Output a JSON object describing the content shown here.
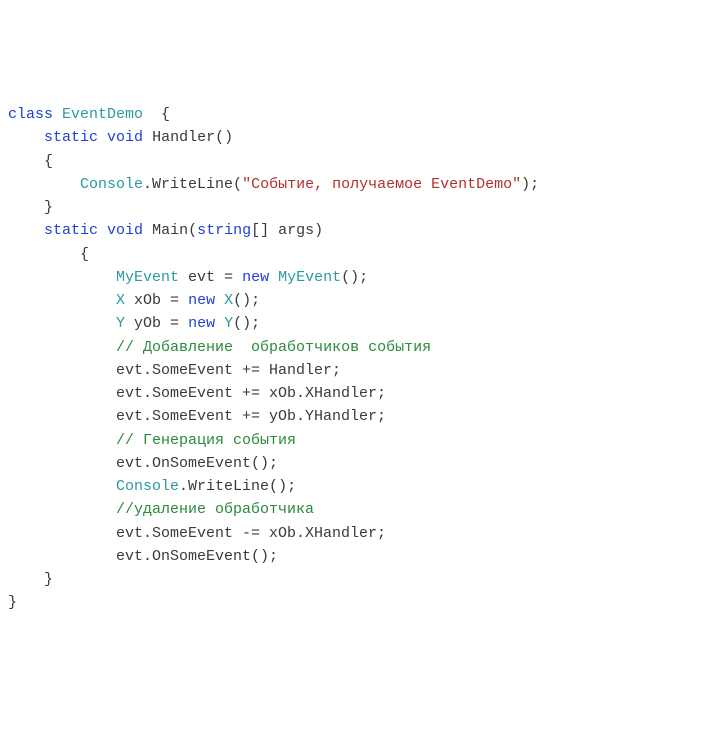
{
  "tokens": [
    [
      [
        "kw",
        "class"
      ],
      [
        "txt",
        " "
      ],
      [
        "type",
        "EventDemo"
      ],
      [
        "txt",
        "  {"
      ]
    ],
    [
      [
        "txt",
        "    "
      ],
      [
        "kw",
        "static"
      ],
      [
        "txt",
        " "
      ],
      [
        "kw",
        "void"
      ],
      [
        "txt",
        " Handler()"
      ]
    ],
    [
      [
        "txt",
        "    {"
      ]
    ],
    [
      [
        "txt",
        "        "
      ],
      [
        "type",
        "Console"
      ],
      [
        "txt",
        ".WriteLine("
      ],
      [
        "str",
        "\"Событие, получаемое EventDemo\""
      ],
      [
        "txt",
        ");"
      ]
    ],
    [
      [
        "txt",
        "    }"
      ]
    ],
    [
      [
        "txt",
        "    "
      ],
      [
        "kw",
        "static"
      ],
      [
        "txt",
        " "
      ],
      [
        "kw",
        "void"
      ],
      [
        "txt",
        " Main("
      ],
      [
        "kw",
        "string"
      ],
      [
        "txt",
        "[] args)"
      ]
    ],
    [
      [
        "txt",
        "        {"
      ]
    ],
    [
      [
        "txt",
        "            "
      ],
      [
        "type",
        "MyEvent"
      ],
      [
        "txt",
        " evt = "
      ],
      [
        "kw",
        "new"
      ],
      [
        "txt",
        " "
      ],
      [
        "type",
        "MyEvent"
      ],
      [
        "txt",
        "();"
      ]
    ],
    [
      [
        "txt",
        "            "
      ],
      [
        "type",
        "X"
      ],
      [
        "txt",
        " xOb = "
      ],
      [
        "kw",
        "new"
      ],
      [
        "txt",
        " "
      ],
      [
        "type",
        "X"
      ],
      [
        "txt",
        "();"
      ]
    ],
    [
      [
        "txt",
        "            "
      ],
      [
        "type",
        "Y"
      ],
      [
        "txt",
        " yOb = "
      ],
      [
        "kw",
        "new"
      ],
      [
        "txt",
        " "
      ],
      [
        "type",
        "Y"
      ],
      [
        "txt",
        "();"
      ]
    ],
    [
      [
        "txt",
        "            "
      ],
      [
        "cmt",
        "// Добавление  обработчиков события"
      ]
    ],
    [
      [
        "txt",
        "            evt.SomeEvent += Handler;"
      ]
    ],
    [
      [
        "txt",
        "            evt.SomeEvent += xOb.XHandler;"
      ]
    ],
    [
      [
        "txt",
        "            evt.SomeEvent += yOb.YHandler;"
      ]
    ],
    [
      [
        "txt",
        "            "
      ],
      [
        "cmt",
        "// Генерация события"
      ]
    ],
    [
      [
        "txt",
        "            evt.OnSomeEvent();"
      ]
    ],
    [
      [
        "txt",
        "            "
      ],
      [
        "type",
        "Console"
      ],
      [
        "txt",
        ".WriteLine();"
      ]
    ],
    [
      [
        "txt",
        "            "
      ],
      [
        "cmt",
        "//удаление обработчика"
      ]
    ],
    [
      [
        "txt",
        "            evt.SomeEvent -= xOb.XHandler;"
      ]
    ],
    [
      [
        "txt",
        "            evt.OnSomeEvent();"
      ]
    ],
    [
      [
        "txt",
        "    }"
      ]
    ],
    [
      [
        "txt",
        "}"
      ]
    ]
  ]
}
